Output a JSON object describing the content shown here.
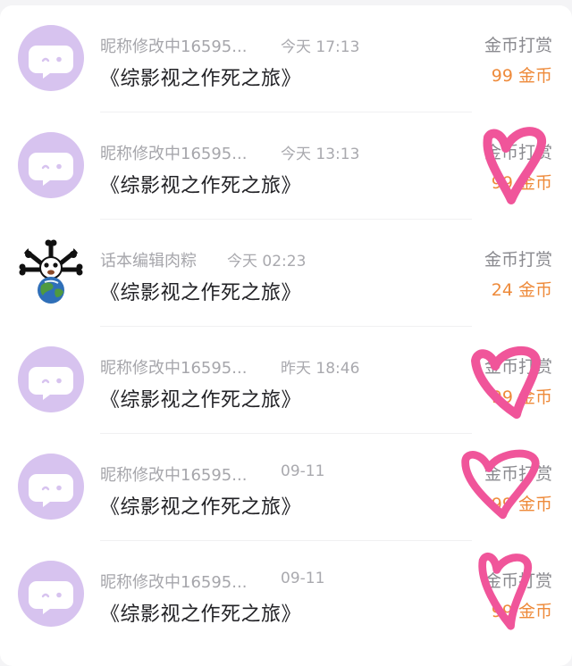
{
  "rows": [
    {
      "name": "昵称修改中16595...",
      "time": "今天 17:13",
      "title": "《综影视之作死之旅》",
      "action": "金币打赏",
      "amount": "99 金币",
      "avatar": "chat-bubble-icon"
    },
    {
      "name": "昵称修改中16595...",
      "time": "今天 13:13",
      "title": "《综影视之作死之旅》",
      "action": "金币打赏",
      "amount": "99 金币",
      "avatar": "chat-bubble-icon"
    },
    {
      "name": "话本编辑肉粽",
      "time": "今天 02:23",
      "title": "《综影视之作死之旅》",
      "action": "金币打赏",
      "amount": "24 金币",
      "avatar": "earth-cartoon-avatar"
    },
    {
      "name": "昵称修改中16595...",
      "time": "昨天 18:46",
      "title": "《综影视之作死之旅》",
      "action": "金币打赏",
      "amount": "99 金币",
      "avatar": "chat-bubble-icon"
    },
    {
      "name": "昵称修改中16595...",
      "time": "09-11",
      "title": "《综影视之作死之旅》",
      "action": "金币打赏",
      "amount": "99 金币",
      "avatar": "chat-bubble-icon"
    },
    {
      "name": "昵称修改中16595...",
      "time": "09-11",
      "title": "《综影视之作死之旅》",
      "action": "金币打赏",
      "amount": "99 金币",
      "avatar": "chat-bubble-icon"
    }
  ],
  "colors": {
    "avatar_bg": "#d7c3ef",
    "amount": "#ee8a3a",
    "heart_doodle": "#f0559a"
  }
}
